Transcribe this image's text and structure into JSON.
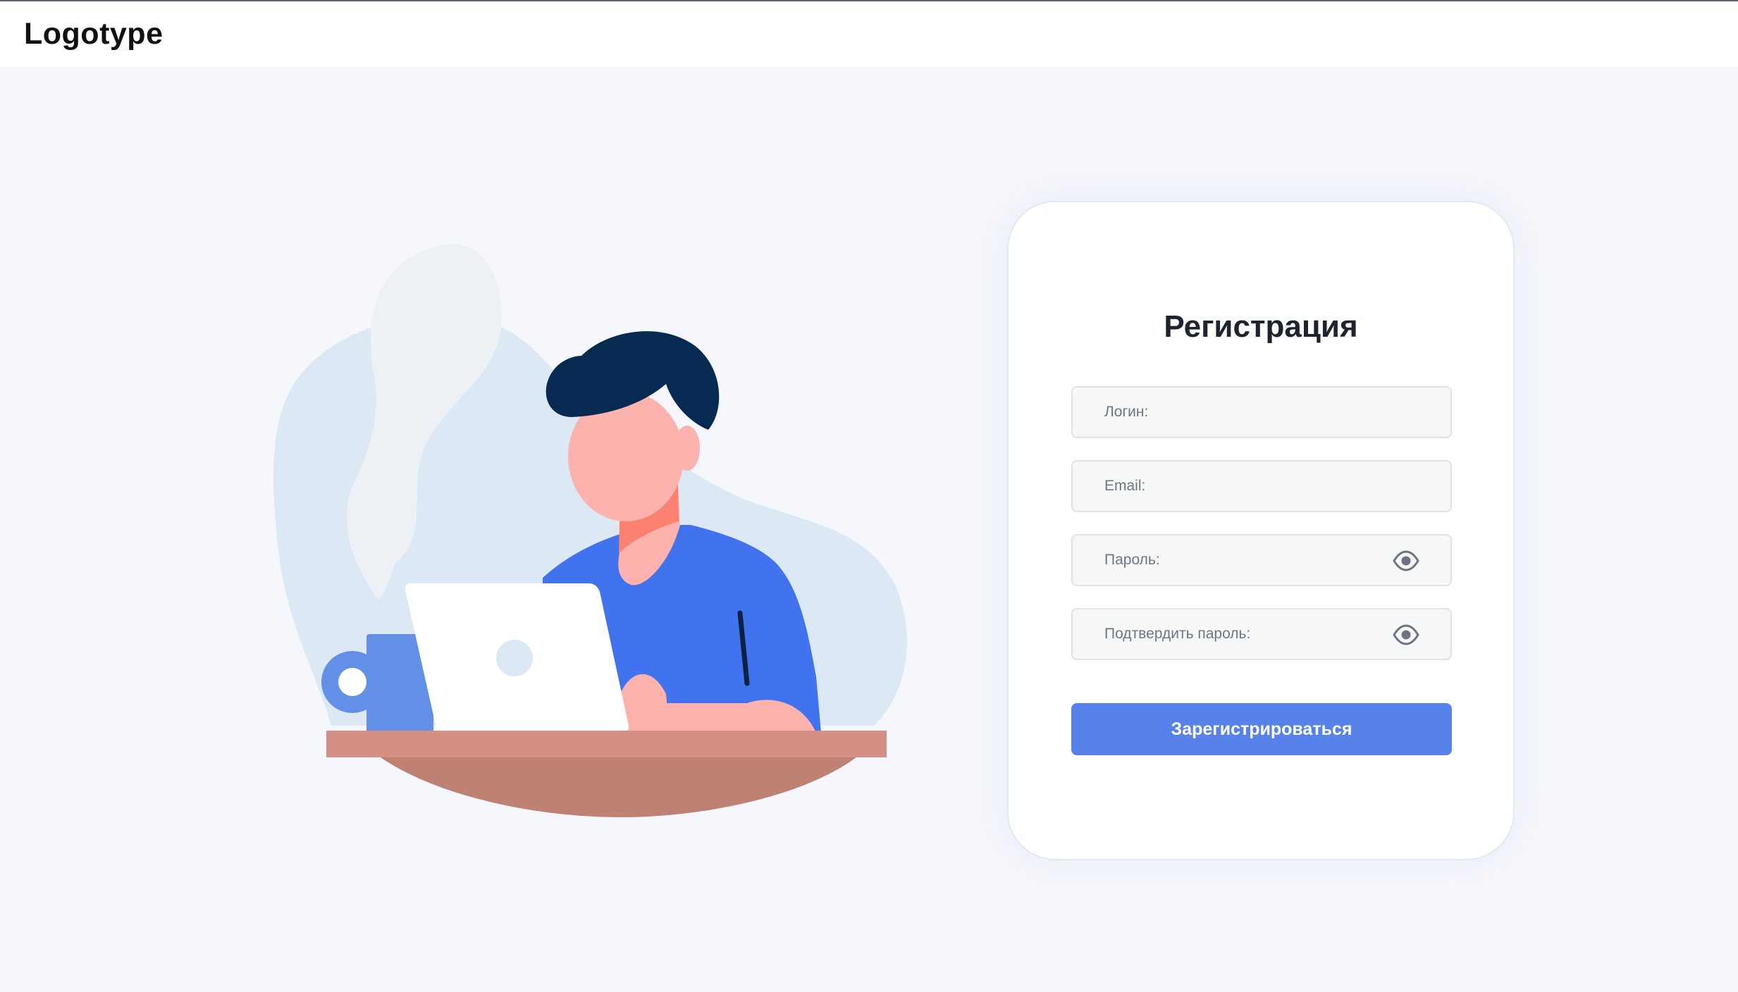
{
  "header": {
    "logo": "Logotype"
  },
  "form": {
    "title": "Регистрация",
    "fields": {
      "login": {
        "placeholder": "Логин:",
        "value": ""
      },
      "email": {
        "placeholder": "Email:",
        "value": ""
      },
      "password": {
        "placeholder": "Пароль:",
        "value": ""
      },
      "confirm_password": {
        "placeholder": "Подтвердить пароль:",
        "value": ""
      }
    },
    "submit_label": "Зарегистрироваться"
  },
  "icons": {
    "password_toggle": "eye-icon",
    "confirm_password_toggle": "eye-icon"
  },
  "colors": {
    "page_background": "#f5f7fc",
    "accent": "#5682ea",
    "shirt": "#4173ef",
    "hair": "#062a52",
    "table": "#d49084"
  }
}
